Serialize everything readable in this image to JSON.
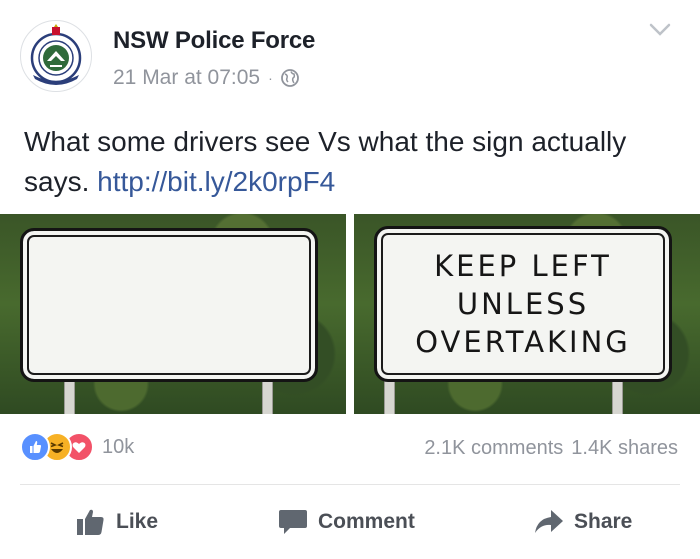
{
  "post": {
    "page_name": "NSW Police Force",
    "timestamp": "21 Mar at 07:05",
    "separator": "·",
    "privacy_icon": "globe-icon",
    "menu_icon": "chevron-down-icon",
    "text": "What some drivers see Vs what the sign actually says.",
    "link": "http://bit.ly/2k0rpF4",
    "avatar_icon": "nsw-police-badge-logo",
    "avatar_logo_text": "NEW SOUTH WALES POLICE FORCE"
  },
  "photos": [
    {
      "description_icon": "blank-road-sign",
      "sign_text": ""
    },
    {
      "description_icon": "keep-left-road-sign",
      "sign_text": "KEEP LEFT\nUNLESS\nOVERTAKING"
    }
  ],
  "engagement": {
    "reaction_icons": [
      "like-reaction-icon",
      "haha-reaction-icon",
      "love-reaction-icon"
    ],
    "reaction_count": "10k",
    "comments": "2.1K comments",
    "shares": "1.4K shares"
  },
  "actions": {
    "like_label": "Like",
    "comment_label": "Comment",
    "share_label": "Share"
  },
  "colors": {
    "text": "#1d2129",
    "meta": "#90949c",
    "link": "#365899",
    "action": "#4b4f56",
    "like_reaction": "#5890ff",
    "haha_reaction": "#f7b125",
    "love_reaction": "#f25268"
  }
}
